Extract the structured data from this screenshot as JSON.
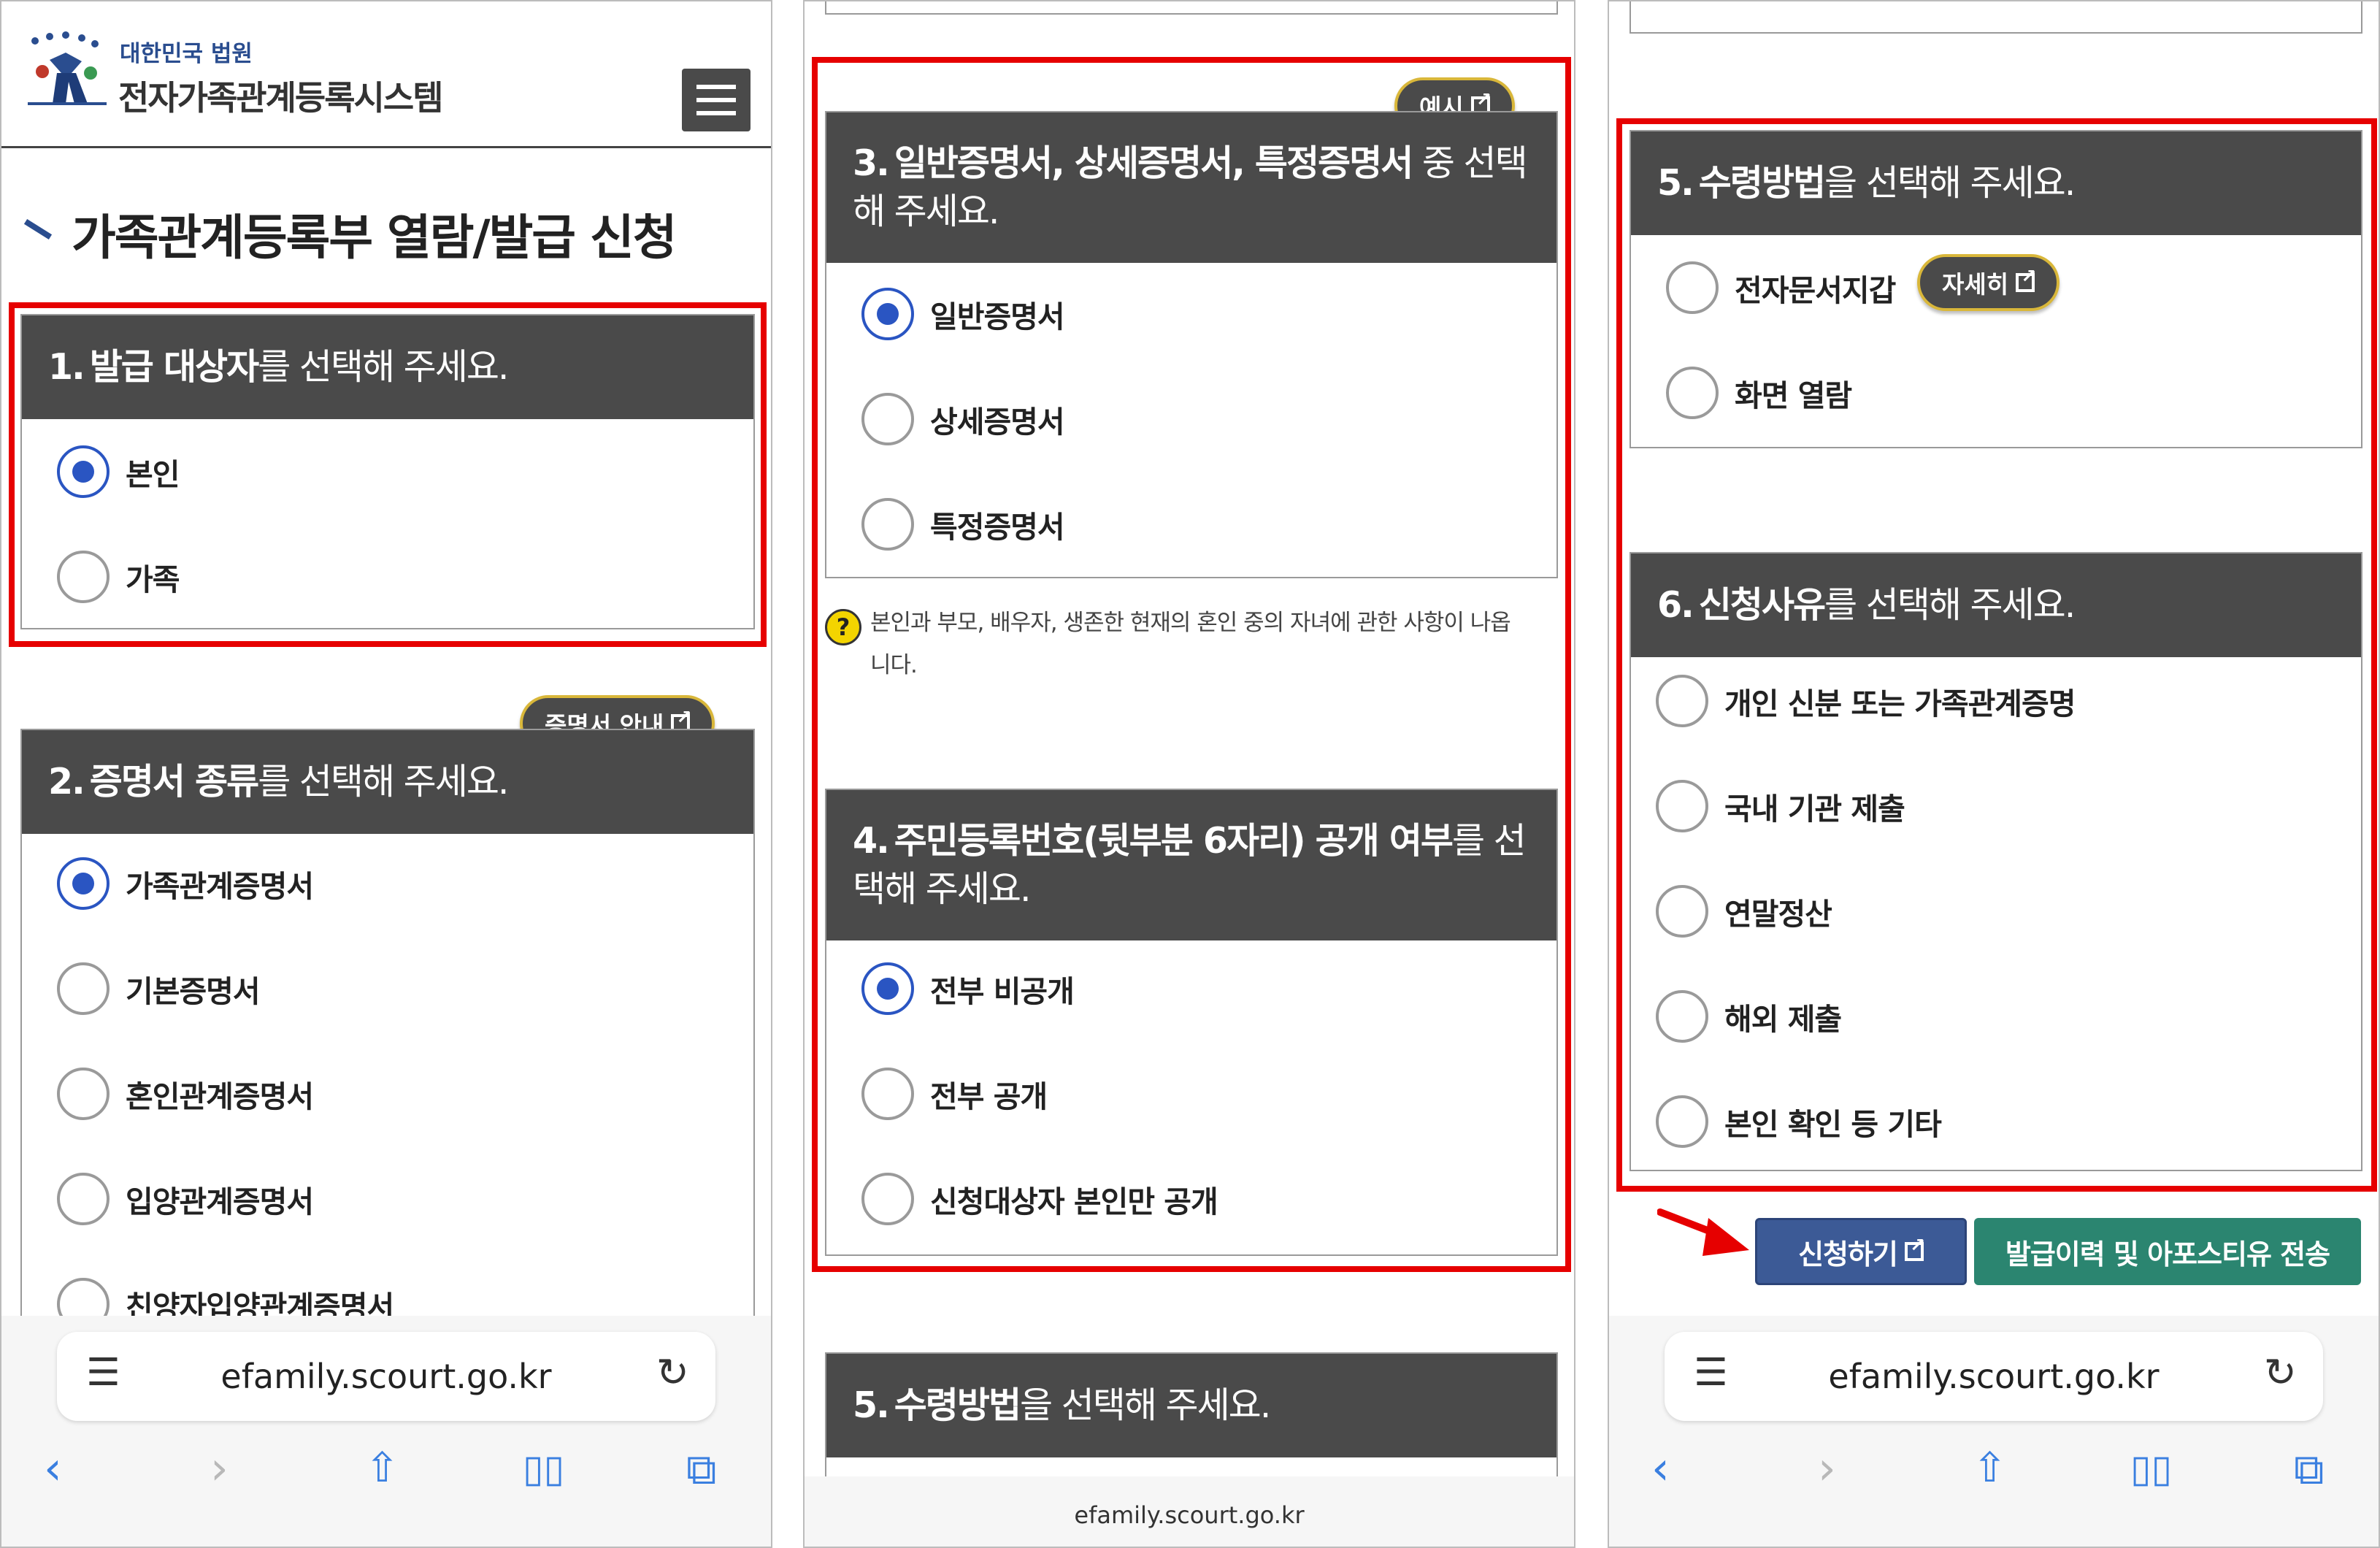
{
  "colors": {
    "header_dark": "#4a4a4a",
    "radio_selected": "#2a55c2",
    "highlight_red": "#e60000",
    "pill_border": "#d9b73a",
    "apply_button": "#3c5a96",
    "history_button": "#2b8570"
  },
  "panel1": {
    "logo": {
      "sub": "대한민국 법원",
      "main": "전자가족관계등록시스템"
    },
    "page_title": "가족관계등록부 열람/발급 신청",
    "section1": {
      "num": "1.",
      "bold": "발급 대상자",
      "rest": "를 선택해 주세요.",
      "options": [
        "본인",
        "가족"
      ],
      "selected": 0
    },
    "section2": {
      "num": "2.",
      "bold": "증명서 종류",
      "rest": "를 선택해 주세요.",
      "pill": "증명서 안내",
      "options": [
        "가족관계증명서",
        "기본증명서",
        "혼인관계증명서",
        "입양관계증명서",
        "친양자입양관계증명서"
      ],
      "selected": 0
    },
    "url": "efamily.scourt.go.kr"
  },
  "panel2": {
    "section3": {
      "pill": "예시",
      "num": "3.",
      "bold": "일반증명서, 상세증명서, 특정증명서",
      "rest": " 중 선택",
      "line2": "해 주세요.",
      "options": [
        "일반증명서",
        "상세증명서",
        "특정증명서"
      ],
      "selected": 0
    },
    "notice_line1": "본인과 부모, 배우자, 생존한 현재의 혼인 중의 자녀에 관한 사항이 나옵",
    "notice_line2": "니다.",
    "section4": {
      "num": "4.",
      "bold": "주민등록번호(뒷부분 6자리) 공개 여부",
      "rest": "를 선",
      "line2": "택해 주세요.",
      "options": [
        "전부 비공개",
        "전부 공개",
        "신청대상자 본인만 공개"
      ],
      "selected": 0
    },
    "section5": {
      "num": "5.",
      "bold": "수령방법",
      "rest": "을 선택해 주세요."
    },
    "url": "efamily.scourt.go.kr"
  },
  "panel3": {
    "section5": {
      "num": "5.",
      "bold": "수령방법",
      "rest": "을 선택해 주세요.",
      "pill": "자세히",
      "options": [
        "전자문서지갑",
        "화면 열람"
      ],
      "selected": -1
    },
    "section6": {
      "num": "6.",
      "bold": "신청사유",
      "rest": "를 선택해 주세요.",
      "options": [
        "개인 신분 또는 가족관계증명",
        "국내 기관 제출",
        "연말정산",
        "해외 제출",
        "본인 확인 등 기타"
      ],
      "selected": -1
    },
    "apply_button": "신청하기",
    "history_button": "발급이력 및 아포스티유 전송",
    "url": "efamily.scourt.go.kr"
  },
  "icons": [
    "court-logo-icon",
    "menu-icon",
    "external-link-icon",
    "question-icon",
    "reader-icon",
    "reload-icon",
    "back-icon",
    "forward-icon",
    "share-icon",
    "bookmarks-icon",
    "tabs-icon",
    "red-arrow-icon"
  ]
}
